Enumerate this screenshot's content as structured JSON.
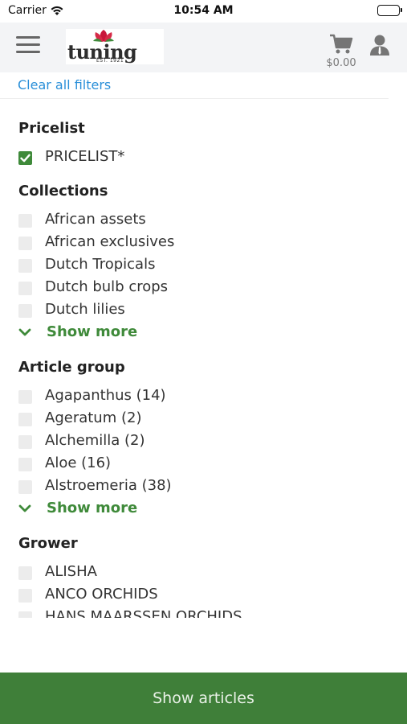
{
  "status": {
    "carrier": "Carrier",
    "time": "10:54 AM"
  },
  "header": {
    "logo_text": "tuning",
    "logo_est": "EST. 1921",
    "cart_total": "$0.00"
  },
  "filters": {
    "clear_label": "Clear all filters",
    "pricelist": {
      "title": "Pricelist",
      "options": [
        {
          "label": "PRICELIST*",
          "checked": true
        }
      ]
    },
    "collections": {
      "title": "Collections",
      "options": [
        {
          "label": "African assets",
          "checked": false
        },
        {
          "label": "African exclusives",
          "checked": false
        },
        {
          "label": "Dutch Tropicals",
          "checked": false
        },
        {
          "label": "Dutch bulb crops",
          "checked": false
        },
        {
          "label": "Dutch lilies",
          "checked": false
        }
      ],
      "show_more": "Show more"
    },
    "article_group": {
      "title": "Article group",
      "options": [
        {
          "label": "Agapanthus (14)",
          "checked": false
        },
        {
          "label": "Ageratum (2)",
          "checked": false
        },
        {
          "label": "Alchemilla (2)",
          "checked": false
        },
        {
          "label": "Aloe (16)",
          "checked": false
        },
        {
          "label": "Alstroemeria (38)",
          "checked": false
        }
      ],
      "show_more": "Show more"
    },
    "grower": {
      "title": "Grower",
      "options": [
        {
          "label": "ALISHA",
          "checked": false
        },
        {
          "label": "ANCO ORCHIDS",
          "checked": false
        },
        {
          "label": "HANS MAARSSEN ORCHIDS",
          "checked": false
        }
      ]
    }
  },
  "footer": {
    "button_label": "Show articles"
  },
  "colors": {
    "accent_green": "#3f8a3a",
    "footer_green": "#3f7f39",
    "link_blue": "#2a8fd8"
  },
  "icons": [
    "wifi-icon",
    "battery-icon",
    "menu-icon",
    "cart-icon",
    "account-icon",
    "check-icon",
    "chevron-down-icon"
  ]
}
